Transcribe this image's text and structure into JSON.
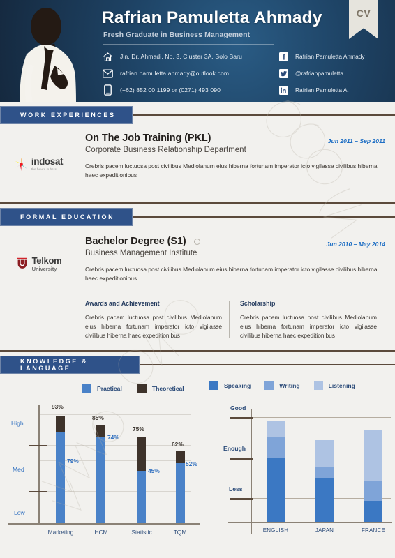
{
  "header": {
    "name": "Rafrian Pamuletta Ahmady",
    "subtitle": "Fresh Graduate in Business Management",
    "ribbon_label": "CV",
    "contacts": [
      {
        "icon": "home-icon",
        "text": "Jln. Dr. Ahmadi, No. 3, Cluster 3A, Solo Baru"
      },
      {
        "icon": "envelope-icon",
        "text": "rafrian.pamuletta.ahmady@outlook.com"
      },
      {
        "icon": "mobile-phone-icon",
        "text": "(+62) 852 00 1199 or (0271) 493 090"
      }
    ],
    "socials": [
      {
        "icon": "facebook-icon",
        "text": "Rafrian Pamuletta Ahmady"
      },
      {
        "icon": "twitter-icon",
        "text": "@rafrianpamuletta"
      },
      {
        "icon": "linkedin-icon",
        "text": "Rafrian Pamuletta A."
      }
    ]
  },
  "sections": {
    "work": {
      "heading": "WORK  EXPERIENCES",
      "logo_name": "indosat",
      "logo_tagline": "the future is here",
      "title": "On The Job Training (PKL)",
      "subtitle": "Corporate Business Relationship Department",
      "date": "Jun 2011 – Sep 2011",
      "description": "Crebris pacem luctuosa post civilibus Mediolanum eius hiberna fortunam imperator icto vigilasse civilibus hiberna haec expeditionibus"
    },
    "education": {
      "heading": "FORMAL  EDUCATION",
      "logo_name": "Telkom",
      "logo_sub": "University",
      "title": "Bachelor Degree (S1)",
      "subtitle": "Business Management Institute",
      "date": "Jun 2010 – May 2014",
      "description": "Crebris pacem luctuosa post civilibus Mediolanum eius hiberna fortunam imperator icto vigilasse civilibus hiberna haec expeditionibus",
      "awards_heading": "Awards and Achievement",
      "awards_text": "Crebris pacem luctuosa post civilibus Mediolanum eius hiberna fortunam imperator icto vigilasse civilibus hiberna haec expeditionibus",
      "scholarship_heading": "Scholarship",
      "scholarship_text": "Crebris pacem luctuosa post civilibus Mediolanum eius hiberna fortunam imperator icto vigilasse civilibus hiberna haec expeditionibus"
    },
    "knowledge": {
      "heading": "KNOWLEDGE  &  LANGUAGE"
    }
  },
  "colors": {
    "header_blue": "#1d3e5c",
    "section_blue": "#2f5289",
    "rule_brown": "#5b4a3c",
    "practical_blue": "#4a82c8",
    "theoretical_brown": "#3e332b",
    "speaking_blue": "#3b78c3",
    "writing_blue": "#7fa4d8",
    "listening_blue": "#aec3e3",
    "page_bg": "#f2f1ee",
    "date_blue": "#1f6fc4"
  },
  "chart_data": [
    {
      "type": "bar",
      "name": "knowledge-chart",
      "stacked": true,
      "categories": [
        "Marketing",
        "HCM",
        "Statistic",
        "TQM"
      ],
      "series": [
        {
          "name": "Practical",
          "color": "#4a82c8",
          "values": [
            79,
            74,
            45,
            52
          ]
        },
        {
          "name": "Theoretical",
          "color": "#3e332b",
          "values": [
            93,
            85,
            75,
            62
          ]
        }
      ],
      "value_labels_total": [
        "93%",
        "85%",
        "75%",
        "62%"
      ],
      "value_labels_practical": [
        "79%",
        "74%",
        "45%",
        "52%"
      ],
      "ylabels": [
        "High",
        "Med",
        "Low"
      ],
      "ylim": [
        0,
        100
      ],
      "grid": true,
      "legend": [
        "Practical",
        "Theoretical"
      ],
      "legend_position": "top"
    },
    {
      "type": "bar",
      "name": "language-chart",
      "stacked": true,
      "categories": [
        "ENGLISH",
        "JAPAN",
        "FRANCE"
      ],
      "series": [
        {
          "name": "Speaking",
          "color": "#3b78c3",
          "values": [
            53,
            37,
            17
          ]
        },
        {
          "name": "Writing",
          "color": "#7fa4d8",
          "values": [
            18,
            9,
            23
          ]
        },
        {
          "name": "Listening",
          "color": "#aec3e3",
          "values": [
            14,
            22,
            42
          ]
        }
      ],
      "ylabels": [
        "Good",
        "Enough",
        "Less"
      ],
      "ylim": [
        0,
        100
      ],
      "grid": true,
      "legend": [
        "Speaking",
        "Writing",
        "Listening"
      ],
      "legend_position": "top"
    }
  ]
}
